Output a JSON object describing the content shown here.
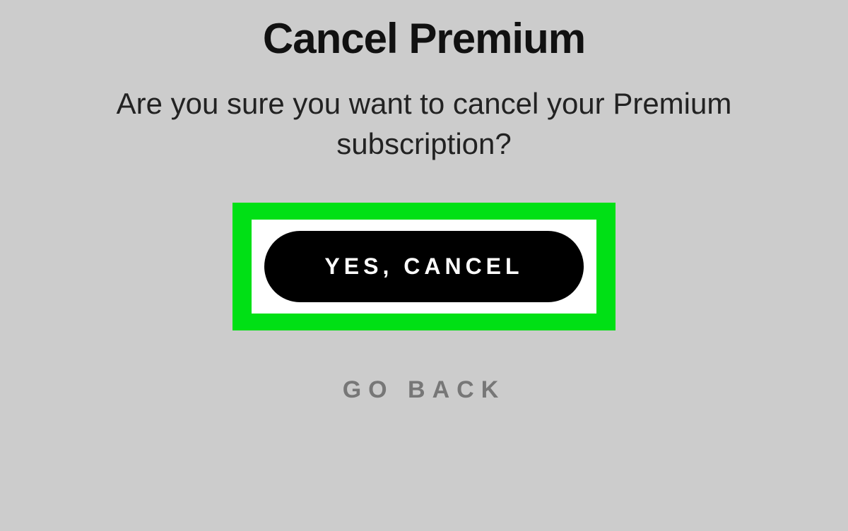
{
  "dialog": {
    "title": "Cancel Premium",
    "subtitle": "Are you sure you want to cancel your Premium subscription?",
    "confirm_label": "YES, CANCEL",
    "back_label": "GO BACK"
  },
  "colors": {
    "highlight": "#00e015",
    "background": "#cccccc",
    "button_bg": "#000000",
    "button_text": "#ffffff"
  }
}
